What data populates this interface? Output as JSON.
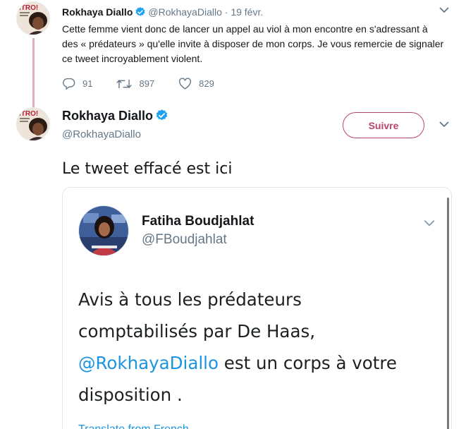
{
  "reply_tweet": {
    "author_name": "Rokhaya Diallo",
    "author_handle": "@RokhayaDiallo",
    "date": "19 févr.",
    "text": "Cette femme vient donc de lancer un appel au viol à mon encontre en s'adressant à des « prédateurs » qu'elle invite à disposer de mon corps. Je vous remercie de signaler ce tweet incroyablement violent.",
    "replies": "91",
    "retweets": "897",
    "likes": "829",
    "avatar_caption": "ITRO!"
  },
  "main_tweet": {
    "author_name": "Rokhaya Diallo",
    "author_handle": "@RokhayaDiallo",
    "follow_label": "Suivre",
    "text": "Le tweet effacé est ici",
    "avatar_caption": "ITRO!"
  },
  "embedded_tweet": {
    "author_name": "Fatiha Boudjahlat",
    "author_handle": "@FBoudjahlat",
    "text_line1": "Avis à tous les prédateurs",
    "text_line2": "comptabilisés par De Haas,",
    "mention": "@RokhayaDiallo",
    "text_line3_rest": " est un corps à votre",
    "text_line4": "disposition .",
    "translate_label": "Translate from French"
  },
  "colors": {
    "accent": "#b8446d",
    "link": "#1b95e0",
    "verified": "#1da1f2",
    "thread_line": "#e0aec0",
    "muted_text": "#657786"
  },
  "icons": [
    "verified-badge-icon",
    "chevron-down-icon",
    "reply-icon",
    "retweet-icon",
    "like-icon"
  ]
}
